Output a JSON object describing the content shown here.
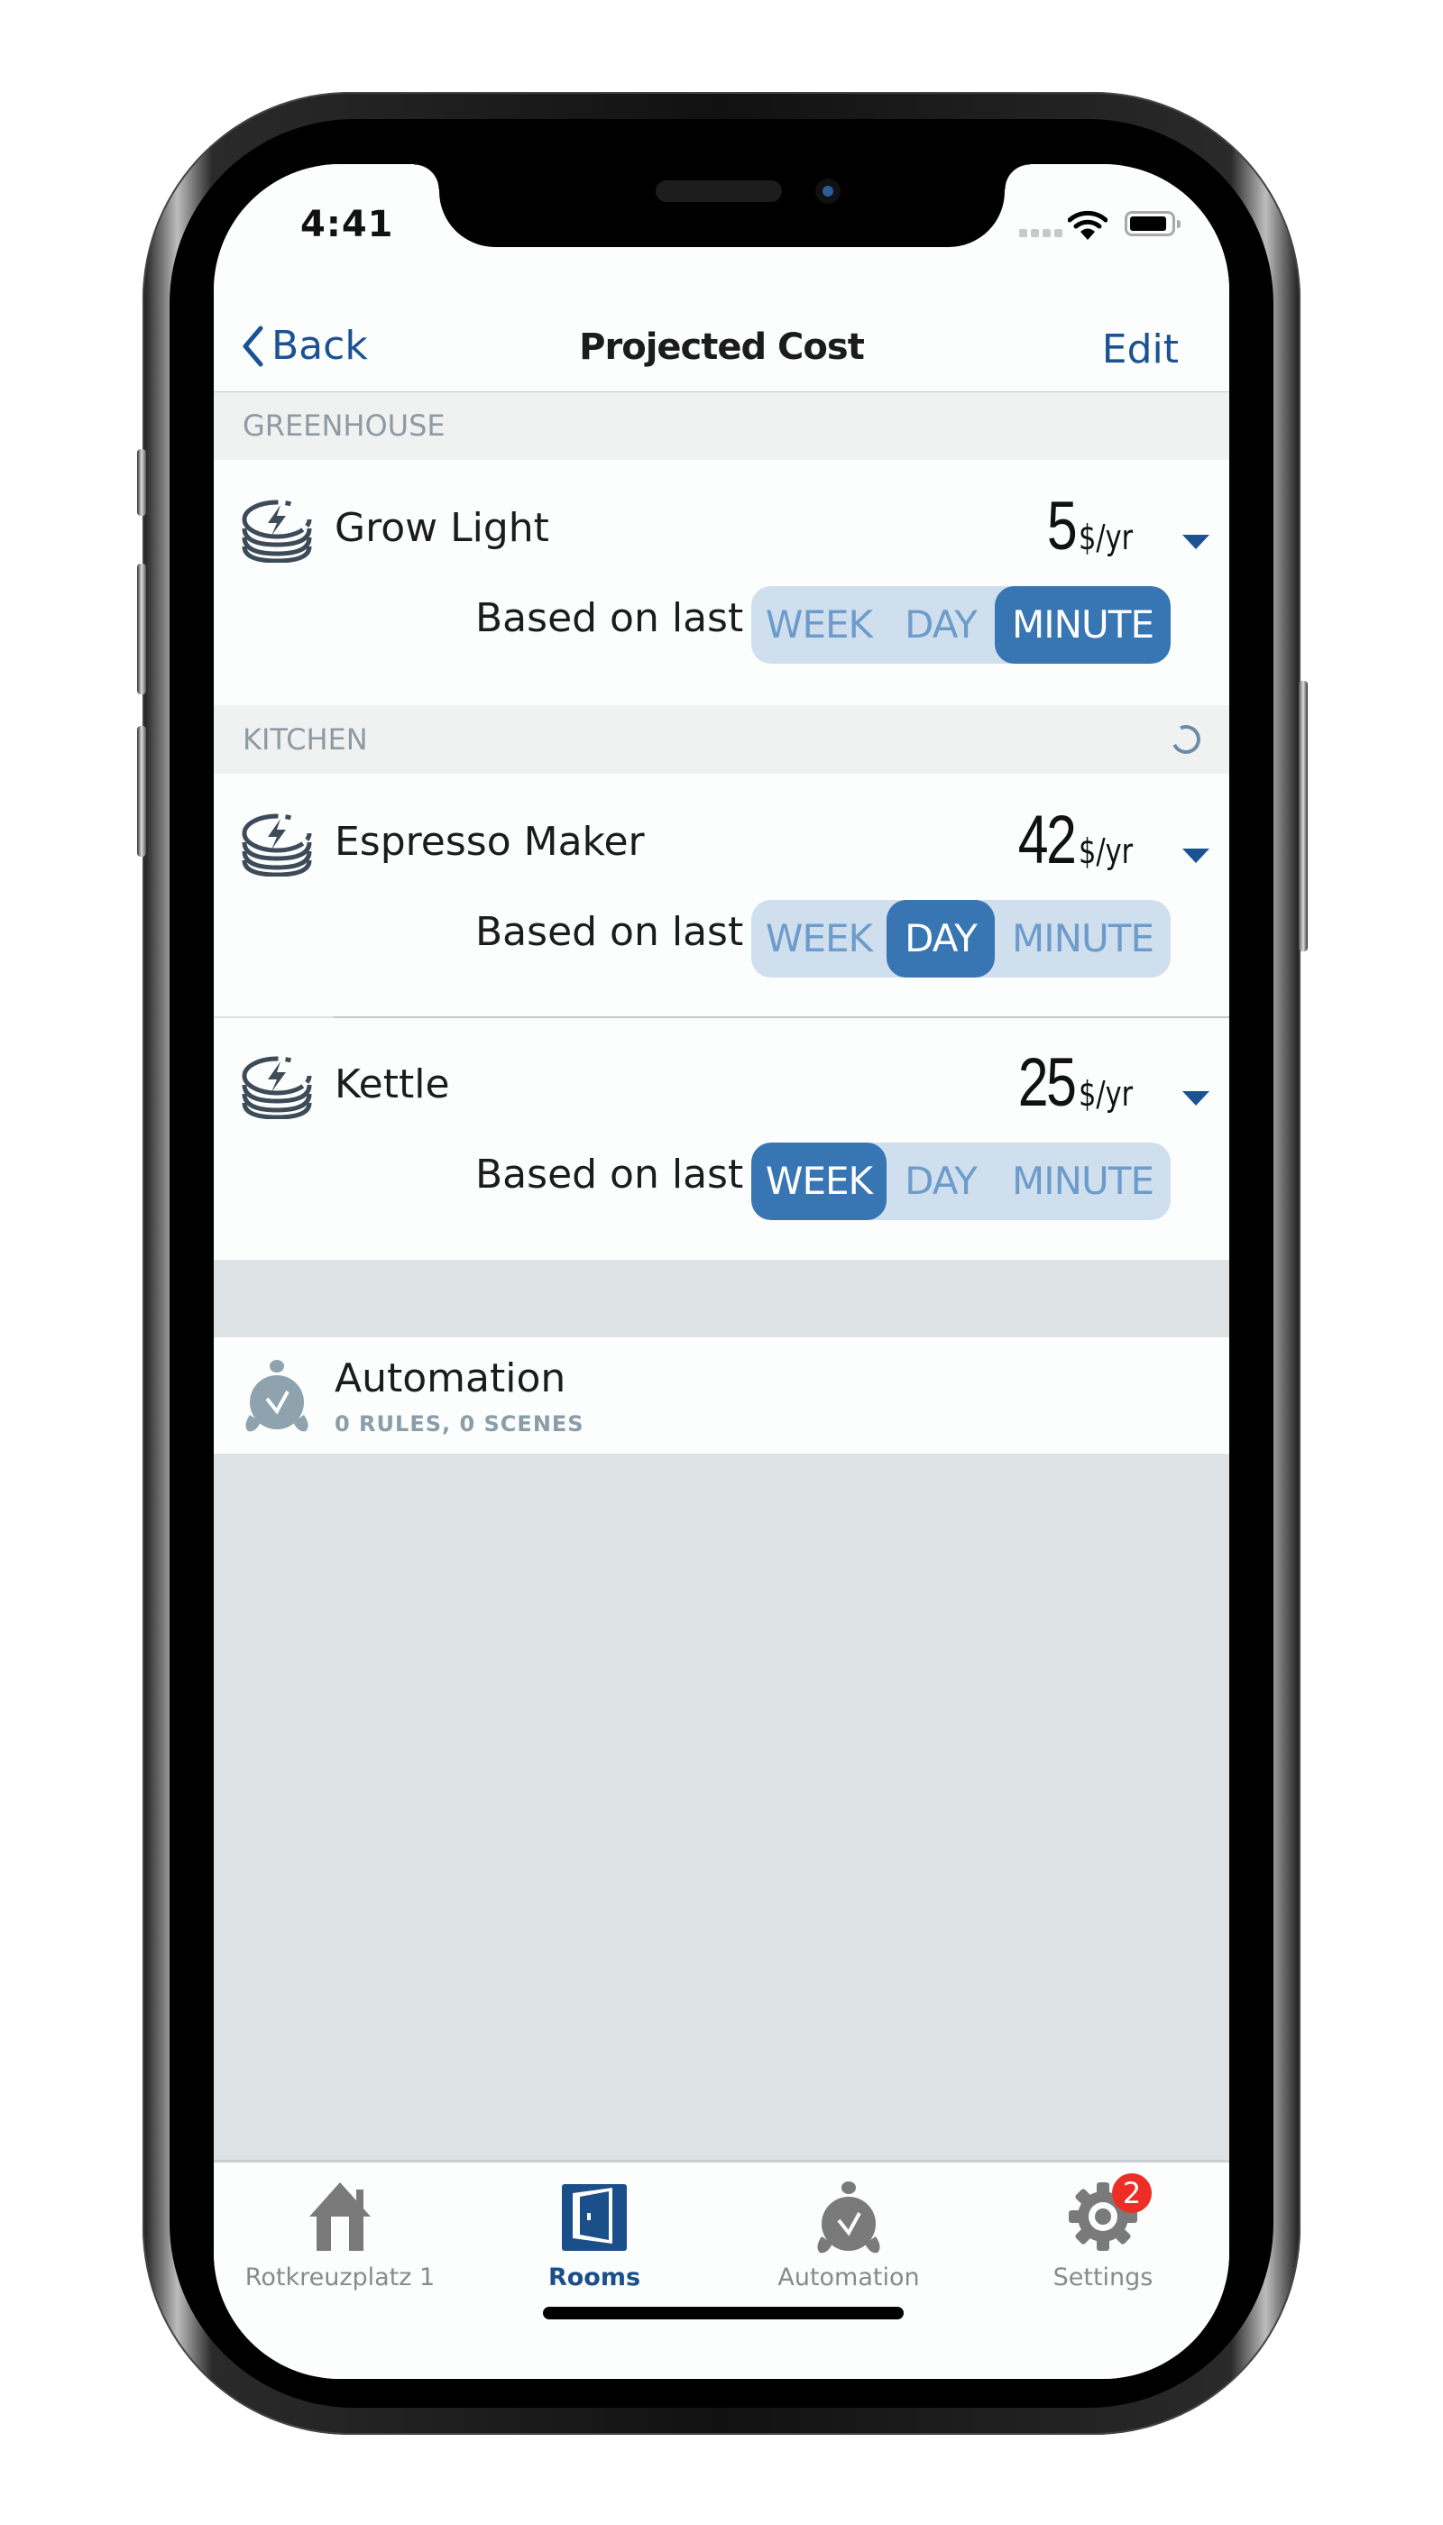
{
  "status_bar": {
    "time": "4:41"
  },
  "nav": {
    "back_label": "Back",
    "title": "Projected Cost",
    "edit_label": "Edit"
  },
  "colors": {
    "accent": "#1a5293",
    "segment_selected": "#3875b3",
    "segment_bg": "#cfdfed",
    "badge": "#ee2d24"
  },
  "sections": [
    {
      "header": "GREENHOUSE",
      "devices": [
        {
          "name": "Grow Light",
          "value": "5",
          "unit": "$/yr",
          "based_label": "Based on last",
          "options": [
            "WEEK",
            "DAY",
            "MINUTE"
          ],
          "selected": "MINUTE"
        }
      ]
    },
    {
      "header": "KITCHEN",
      "loading": true,
      "devices": [
        {
          "name": "Espresso Maker",
          "value": "42",
          "unit": "$/yr",
          "based_label": "Based on last",
          "options": [
            "WEEK",
            "DAY",
            "MINUTE"
          ],
          "selected": "DAY"
        },
        {
          "name": "Kettle",
          "value": "25",
          "unit": "$/yr",
          "based_label": "Based on last",
          "options": [
            "WEEK",
            "DAY",
            "MINUTE"
          ],
          "selected": "WEEK"
        }
      ]
    }
  ],
  "automation": {
    "title": "Automation",
    "subtitle": "0 RULES, 0 SCENES",
    "icon": "alarm-clock-check-icon"
  },
  "tabbar": {
    "tabs": [
      {
        "label": "Rotkreuzplatz 1",
        "icon": "house-icon",
        "active": false
      },
      {
        "label": "Rooms",
        "icon": "door-icon",
        "active": true
      },
      {
        "label": "Automation",
        "icon": "alarm-clock-check-icon",
        "active": false
      },
      {
        "label": "Settings",
        "icon": "gear-icon",
        "active": false,
        "badge": "2"
      }
    ]
  }
}
